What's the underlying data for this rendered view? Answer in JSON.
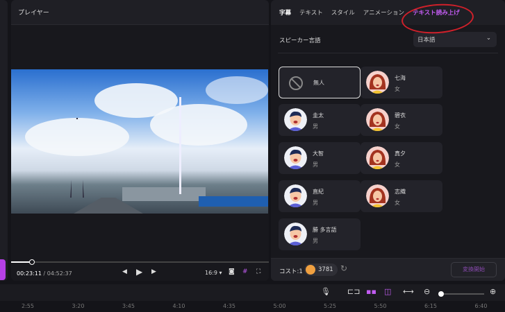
{
  "player": {
    "title": "プレイヤー",
    "current_time": "00:23:11",
    "total_time": "/ 04:52:37",
    "aspect": "16:9 ▾",
    "progress_percent": 8
  },
  "tabs": [
    {
      "label": "字幕"
    },
    {
      "label": "テキスト"
    },
    {
      "label": "スタイル"
    },
    {
      "label": "アニメーション"
    },
    {
      "label": "テキスト読み上げ"
    }
  ],
  "speaker": {
    "label": "スピーカー言語",
    "value": "日本語"
  },
  "voices": [
    {
      "name": "無人",
      "gender": ""
    },
    {
      "name": "七海",
      "gender": "女"
    },
    {
      "name": "圭太",
      "gender": "男"
    },
    {
      "name": "碧衣",
      "gender": "女"
    },
    {
      "name": "大智",
      "gender": "男"
    },
    {
      "name": "真夕",
      "gender": "女"
    },
    {
      "name": "直紀",
      "gender": "男"
    },
    {
      "name": "志織",
      "gender": "女"
    },
    {
      "name": "勝 多言語",
      "gender": "男"
    }
  ],
  "footer": {
    "cost": "コスト:1",
    "coins": "3781",
    "convert": "変換開始"
  },
  "timeline": {
    "ticks": [
      "2:55",
      "3:20",
      "3:45",
      "4:10",
      "4:35",
      "5:00",
      "5:25",
      "5:50",
      "6:15",
      "6:40"
    ]
  },
  "colors": {
    "accent": "#c25cf2",
    "annotation": "#d0202a"
  }
}
